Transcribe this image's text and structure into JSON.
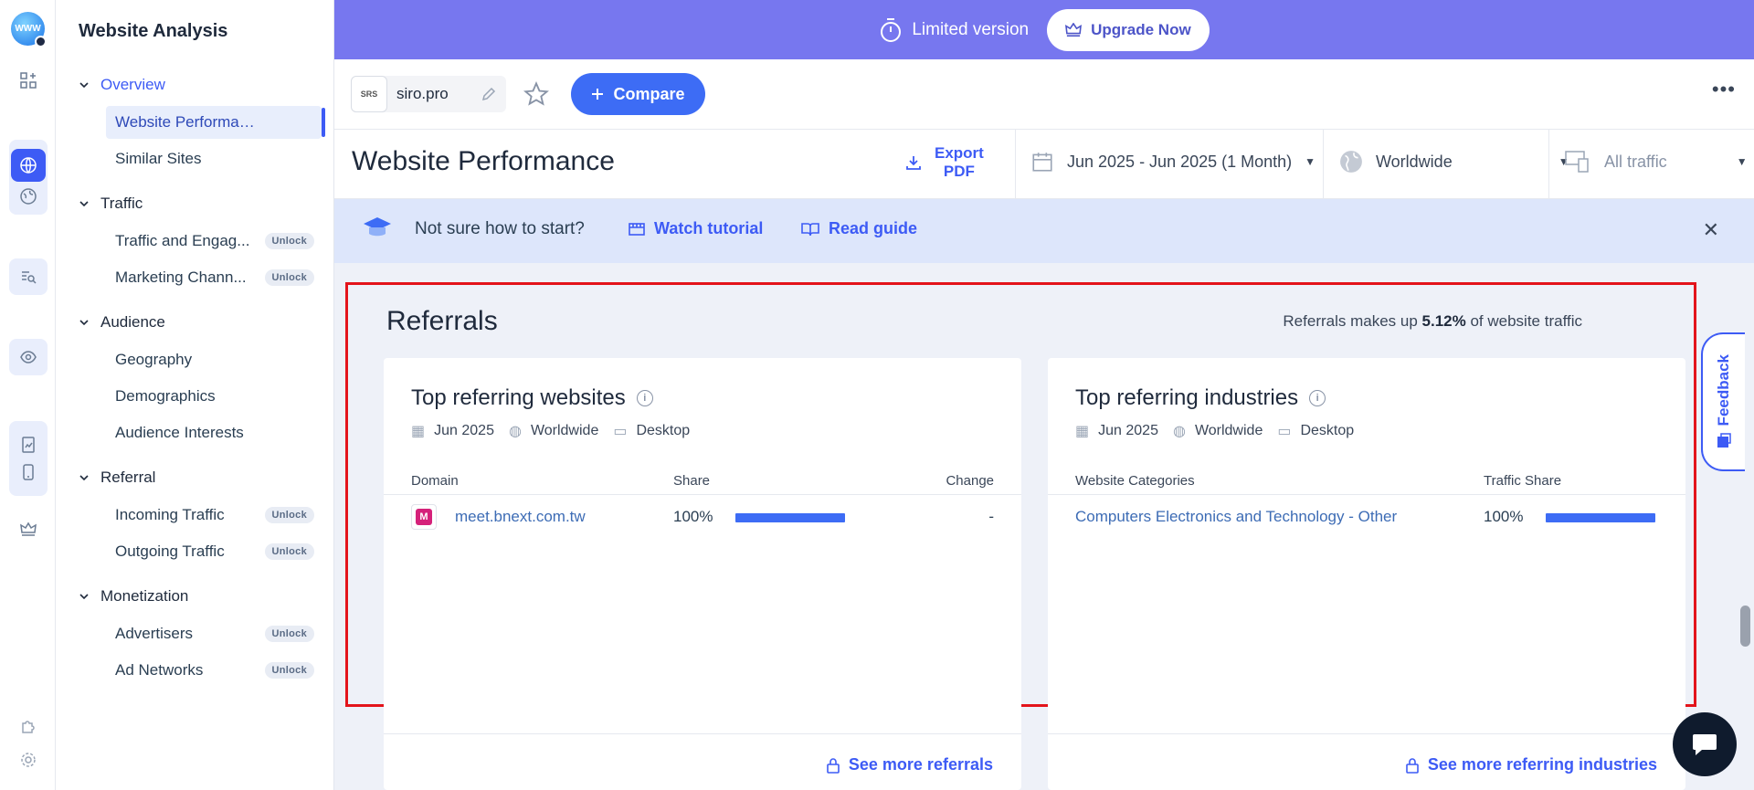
{
  "rail": {
    "logo_text": "WWW"
  },
  "sidebar": {
    "title": "Website Analysis",
    "groups": [
      {
        "label": "Overview",
        "items": [
          {
            "label": "Website Performance"
          },
          {
            "label": "Similar Sites"
          }
        ]
      },
      {
        "label": "Traffic",
        "items": [
          {
            "label": "Traffic and Engag...",
            "badge": "Unlock"
          },
          {
            "label": "Marketing Chann...",
            "badge": "Unlock"
          }
        ]
      },
      {
        "label": "Audience",
        "items": [
          {
            "label": "Geography"
          },
          {
            "label": "Demographics"
          },
          {
            "label": "Audience Interests"
          }
        ]
      },
      {
        "label": "Referral",
        "items": [
          {
            "label": "Incoming Traffic",
            "badge": "Unlock"
          },
          {
            "label": "Outgoing Traffic",
            "badge": "Unlock"
          }
        ]
      },
      {
        "label": "Monetization",
        "items": [
          {
            "label": "Advertisers",
            "badge": "Unlock"
          },
          {
            "label": "Ad Networks",
            "badge": "Unlock"
          }
        ]
      }
    ]
  },
  "banner": {
    "limited": "Limited version",
    "upgrade": "Upgrade Now"
  },
  "sitebar": {
    "favicon_text": "SRS",
    "site": "siro.pro",
    "compare": "Compare"
  },
  "header": {
    "title": "Website Performance",
    "export_line1": "Export",
    "export_line2": "PDF",
    "date_range": "Jun 2025 - Jun 2025 (1 Month)",
    "region": "Worldwide",
    "traffic": "All traffic"
  },
  "tutorial": {
    "question": "Not sure how to start?",
    "watch": "Watch tutorial",
    "read": "Read guide"
  },
  "referrals": {
    "title": "Referrals",
    "note_prefix": "Referrals makes up",
    "note_value": "5.12%",
    "note_suffix": "of website traffic",
    "websites": {
      "title": "Top referring websites",
      "date": "Jun 2025",
      "region": "Worldwide",
      "device": "Desktop",
      "col_domain": "Domain",
      "col_share": "Share",
      "col_change": "Change",
      "rows": [
        {
          "favicon_text": "M",
          "domain": "meet.bnext.com.tw",
          "share": "100%",
          "share_value": 1.0,
          "change": "-"
        }
      ],
      "see_more": "See more referrals"
    },
    "industries": {
      "title": "Top referring industries",
      "date": "Jun 2025",
      "region": "Worldwide",
      "device": "Desktop",
      "col_category": "Website Categories",
      "col_share": "Traffic Share",
      "rows": [
        {
          "category": "Computers Electronics and Technology - Other",
          "share": "100%",
          "share_value": 1.0
        }
      ],
      "see_more": "See more referring industries"
    }
  },
  "feedback": {
    "label": "Feedback"
  },
  "colors": {
    "accent": "#3d5bf5",
    "banner": "#7777ef",
    "highlight": "#e3141b"
  }
}
